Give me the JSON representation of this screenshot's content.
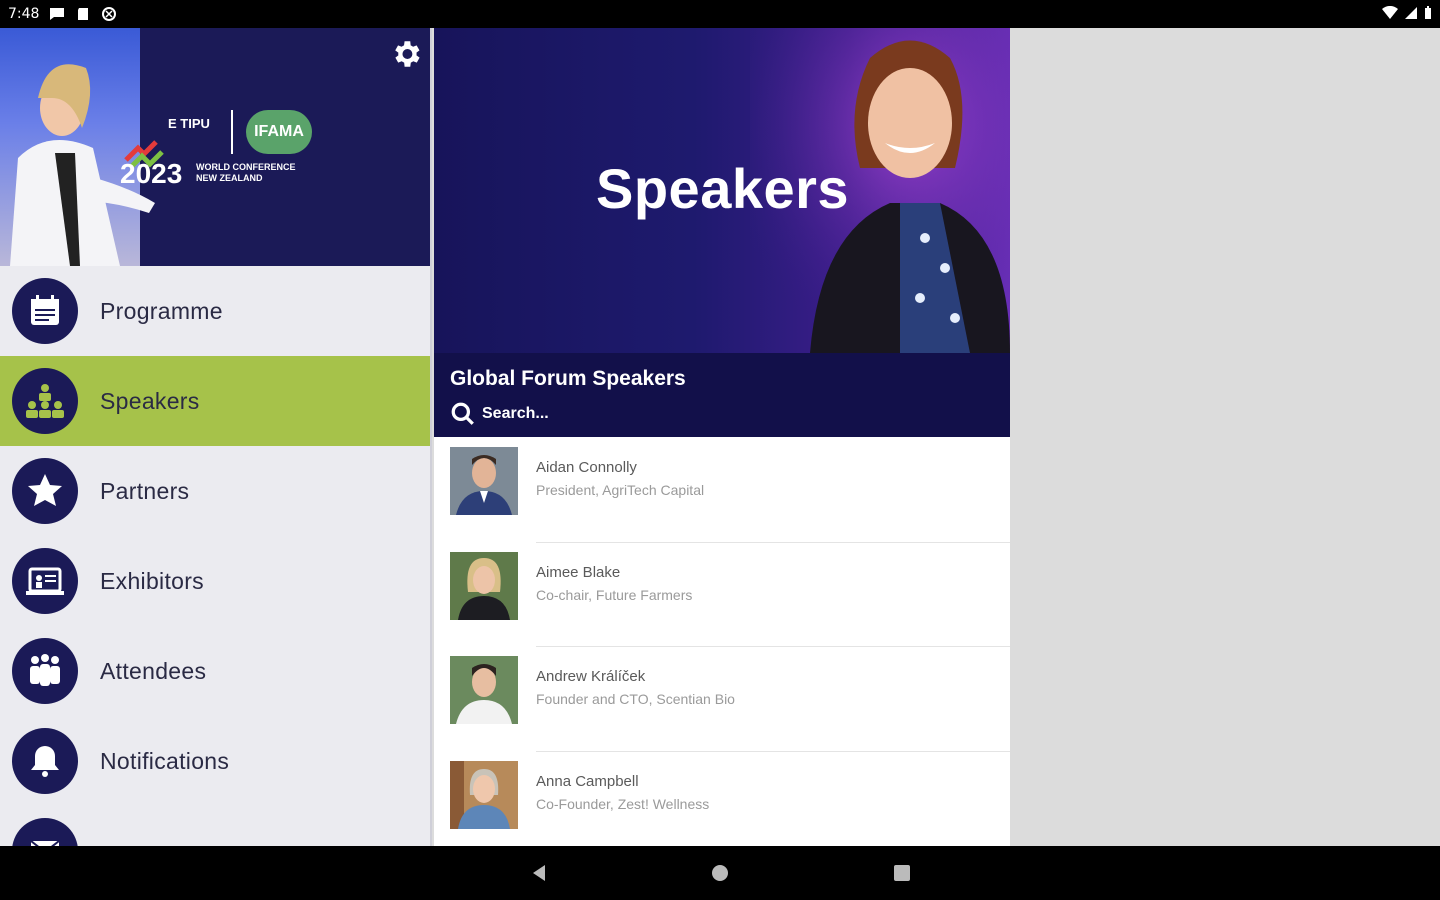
{
  "status_bar": {
    "time": "7:48"
  },
  "drawer": {
    "header": {
      "logo_etipu": "E TIPU",
      "logo_year": "2023",
      "logo_sub_line1": "WORLD CONFERENCE",
      "logo_sub_line2": "NEW ZEALAND",
      "logo_ifama": "IFAMA"
    },
    "items": [
      {
        "label": "Programme",
        "icon": "calendar-icon",
        "active": false
      },
      {
        "label": "Speakers",
        "icon": "speakers-icon",
        "active": true
      },
      {
        "label": "Partners",
        "icon": "star-icon",
        "active": false
      },
      {
        "label": "Exhibitors",
        "icon": "exhibitor-icon",
        "active": false
      },
      {
        "label": "Attendees",
        "icon": "attendees-icon",
        "active": false
      },
      {
        "label": "Notifications",
        "icon": "bell-icon",
        "active": false
      }
    ]
  },
  "main": {
    "banner_title": "Speakers",
    "list_title": "Global Forum Speakers",
    "search_placeholder": "Search...",
    "speakers": [
      {
        "name": "Aidan Connolly",
        "role": "President, AgriTech Capital"
      },
      {
        "name": "Aimee Blake",
        "role": "Co-chair, Future Farmers"
      },
      {
        "name": "Andrew Králíček",
        "role": "Founder and CTO, Scentian Bio"
      },
      {
        "name": "Anna Campbell",
        "role": "Co-Founder, Zest! Wellness"
      }
    ]
  },
  "colors": {
    "navy": "#1b1a57",
    "active_green": "#a6c24a",
    "list_header": "#12104a"
  }
}
